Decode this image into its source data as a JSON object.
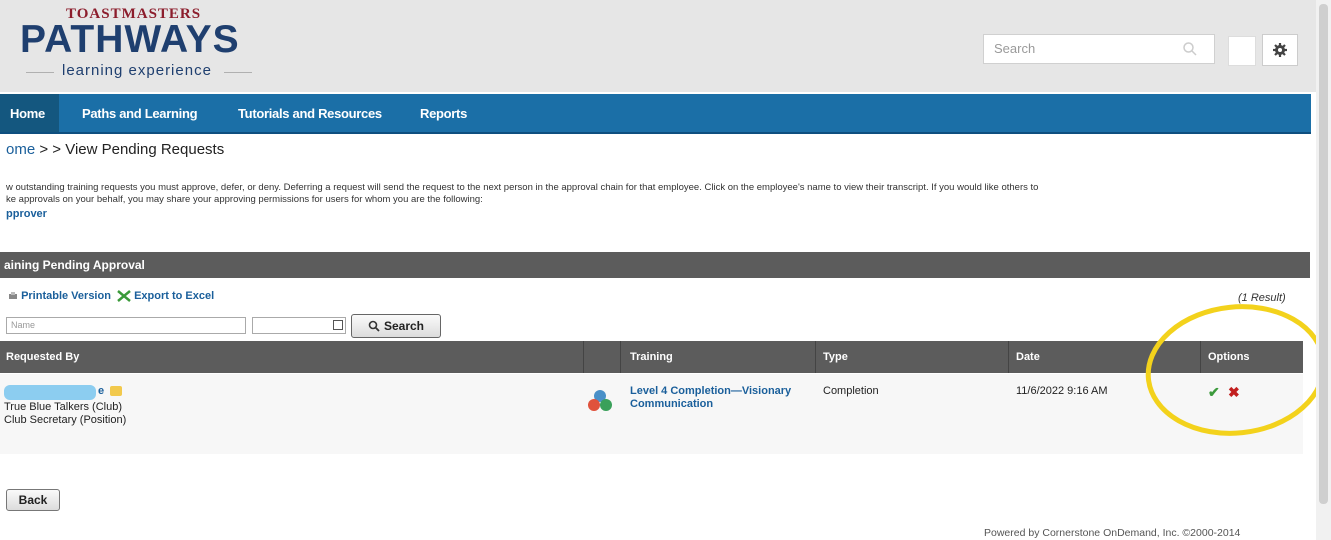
{
  "header": {
    "logo_top": "TOASTMASTERS",
    "logo_main": "PATHWAYS",
    "logo_sub": "learning experience",
    "search_placeholder": "Search"
  },
  "nav": {
    "items": [
      {
        "label": "Home"
      },
      {
        "label": "Paths and Learning"
      },
      {
        "label": "Tutorials and Resources"
      },
      {
        "label": "Reports"
      }
    ]
  },
  "breadcrumb": {
    "home": "ome",
    "rest": " >  > View Pending Requests"
  },
  "intro": {
    "line1": "w outstanding training requests you must approve, defer, or deny. Deferring a request will send the request to the next person in the approval chain for that employee. Click on the employee's name to view their transcript. If you would like others to",
    "line2": "ke approvals on your behalf, you may share your approving permissions for users for whom you are the following:",
    "approver": "pprover"
  },
  "section": {
    "title": "aining Pending Approval",
    "printable": "Printable Version",
    "export": "Export to Excel",
    "result_count": "(1 Result)",
    "name_placeholder": "Name",
    "search_button": "Search"
  },
  "table": {
    "headers": [
      "Requested By",
      "Training",
      "Type",
      "Date",
      "Options"
    ],
    "row": {
      "requester_suffix": "e",
      "club": "True Blue Talkers (Club)",
      "position": "Club Secretary (Position)",
      "training_line1": "Level 4 Completion—Visionary",
      "training_line2": "Communication",
      "type": "Completion",
      "date": "11/6/2022 9:16 AM"
    }
  },
  "footer": {
    "back": "Back",
    "powered": "Powered by Cornerstone OnDemand, Inc. ©2000-2014"
  },
  "colors": {
    "nav": "#1b6fa7",
    "bar": "#5c5c5c",
    "link": "#1a5f9b",
    "highlight": "#f3d21c"
  }
}
